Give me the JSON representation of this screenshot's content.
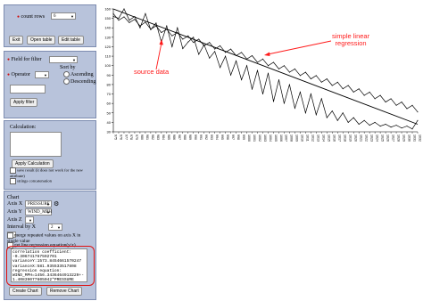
{
  "left_panel": {
    "count": {
      "label": "count rows",
      "value": "6",
      "exit_label": "Exit",
      "open_label": "Open table",
      "edit_label": "Edit table"
    },
    "filter": {
      "field_label": "Field for filter",
      "operator_label": "Operator",
      "sort_label": "Sort by",
      "ascending_label": "Ascending",
      "descending_label": "Descending",
      "apply_label": "Apply filter"
    },
    "calc": {
      "label": "Calculation:",
      "button_label": "Apply Calculation",
      "option1": "save result (it does not work for the new attribute)",
      "option2": "strings concatenation"
    },
    "chart": {
      "label": "Chart",
      "axis_x_label": "Axis X",
      "axis_x_value": "PRESSURE",
      "axis_y_label": "Axis Y",
      "axis_y_value": "WIND_MPH",
      "axis_z_label": "Axis Z",
      "interval_label": "Interval by",
      "interval_value": "X",
      "interval_num": "2",
      "merge_label": "merge repeated values on axis X in single value",
      "regression_label": "get line regression equation(y/x)",
      "output_text": "correlation coefficient:\n-0.306741767592701\nvarianceY:1573.8454661570247\nvarianceX:581.93553351​7808\nregression equation:\nWIND_MPH=1456.343646491​3229+-\n1.4083907760504​2*PRESSURE",
      "create_label": "Create Chart",
      "remove_label": "Remove Chart"
    }
  },
  "annotations": {
    "source_data": "source data",
    "regression_line1": "simple linear",
    "regression_line2": "regression"
  },
  "chart_data": {
    "type": "line",
    "title": "",
    "ylim": [
      30,
      160
    ],
    "y_ticks": [
      30,
      40,
      50,
      60,
      70,
      80,
      90,
      100,
      110,
      120,
      130,
      140,
      150,
      160
    ],
    "x_range": [
      975,
      1032
    ],
    "x": [
      975,
      976,
      977,
      978,
      979,
      980,
      981,
      982,
      983,
      984,
      985,
      986,
      987,
      988,
      989,
      990,
      991,
      992,
      993,
      994,
      995,
      996,
      997,
      998,
      999,
      1000,
      1001,
      1002,
      1003,
      1004,
      1005,
      1006,
      1007,
      1008,
      1009,
      1010,
      1011,
      1012,
      1013,
      1014,
      1015,
      1016,
      1017,
      1018,
      1019,
      1020,
      1021,
      1022,
      1023,
      1024,
      1025,
      1026,
      1027,
      1028,
      1029,
      1030,
      1031,
      1032
    ],
    "series": [
      {
        "values": [
          152,
          150,
          160,
          148,
          152,
          140,
          155,
          138,
          145,
          125,
          142,
          120,
          140,
          118,
          125,
          130,
          112,
          122,
          108,
          115,
          98,
          110,
          90,
          105,
          85,
          100,
          75,
          95,
          70,
          92,
          62,
          85,
          60,
          80,
          55,
          72,
          50,
          70,
          48,
          65,
          45,
          52,
          42,
          50,
          40,
          45,
          38,
          42,
          37,
          40,
          36,
          38,
          35,
          37,
          34,
          36,
          33,
          42
        ]
      },
      {
        "values": [
          155,
          148,
          151.6,
          145.5,
          149,
          142,
          146,
          138.5,
          142,
          135,
          138.5,
          131.5,
          135,
          128,
          131.5,
          124.5,
          128,
          121,
          124.5,
          117.5,
          121,
          114,
          117.5,
          110.5,
          114,
          107,
          110.5,
          103.5,
          107,
          100,
          103.5,
          96.5,
          100,
          93,
          96.5,
          89.5,
          93,
          86,
          89.5,
          82.5,
          86,
          79,
          82.5,
          75.5,
          79,
          72,
          75.5,
          68.5,
          72,
          65,
          68.5,
          61.5,
          65,
          58,
          61.5,
          54.5,
          58,
          51
        ]
      }
    ],
    "regression_line": {
      "from": [
        975,
        160
      ],
      "to": [
        1032,
        38
      ]
    },
    "grid": false
  }
}
